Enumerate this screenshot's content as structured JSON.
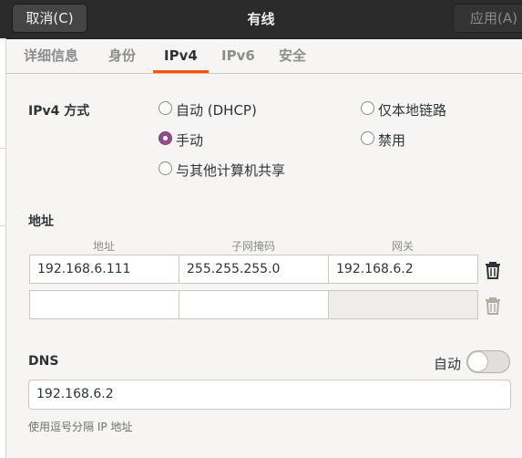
{
  "header": {
    "cancel_label": "取消(C)",
    "title": "有线",
    "apply_label": "应用(A)"
  },
  "tabs": [
    {
      "label": "详细信息"
    },
    {
      "label": "身份"
    },
    {
      "label": "IPv4",
      "active": true
    },
    {
      "label": "IPv6"
    },
    {
      "label": "安全"
    }
  ],
  "ipv4": {
    "method_label": "IPv4 方式",
    "methods": [
      {
        "label": "自动 (DHCP)",
        "checked": false
      },
      {
        "label": "仅本地链路",
        "checked": false
      },
      {
        "label": "手动",
        "checked": true
      },
      {
        "label": "禁用",
        "checked": false
      },
      {
        "label": "与其他计算机共享",
        "checked": false
      }
    ]
  },
  "addresses": {
    "section_label": "地址",
    "columns": [
      "地址",
      "子网掩码",
      "网关"
    ],
    "rows": [
      [
        "192.168.6.111",
        "255.255.255.0",
        "192.168.6.2"
      ],
      [
        "",
        "",
        ""
      ]
    ]
  },
  "dns": {
    "label": "DNS",
    "auto_label": "自动",
    "auto_enabled": false,
    "value": "192.168.6.2",
    "hint": "使用逗号分隔 IP 地址"
  },
  "colors": {
    "accent": "#e95420",
    "radio_checked": "#924d8b",
    "headerbar": "#2b2b2b"
  }
}
